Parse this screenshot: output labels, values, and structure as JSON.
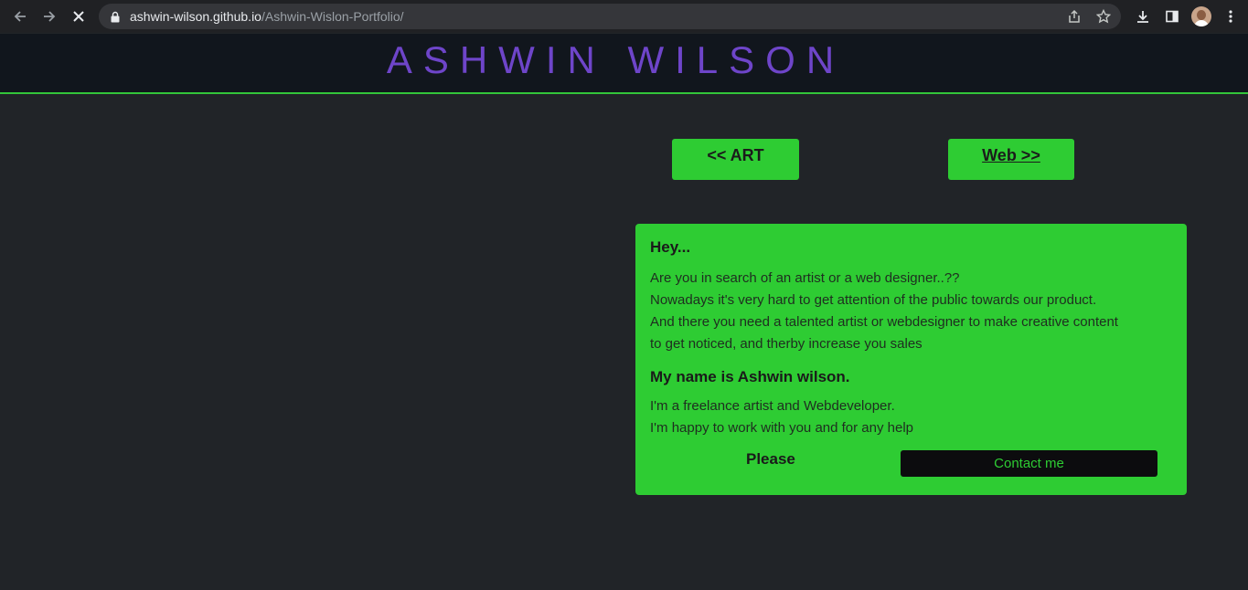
{
  "browser": {
    "url_host": "ashwin-wilson.github.io",
    "url_path": "/Ashwin-Wislon-Portfolio/",
    "icons": [
      "back-icon",
      "forward-icon",
      "stop-icon",
      "lock-icon",
      "share-icon",
      "star-icon",
      "download-icon",
      "sidepanel-icon",
      "profile-avatar",
      "menu-icon"
    ]
  },
  "header": {
    "title": "ASHWIN WILSON"
  },
  "nav": {
    "art_label": "<< ART",
    "web_label": "Web >>"
  },
  "card": {
    "greeting": "Hey...",
    "intro_lines": [
      "Are you in search of an artist or a web designer..??",
      "Nowadays it's very hard to get attention of the public towards our product.",
      "And there you need a talented artist or webdesigner to make creative content",
      "to get noticed, and therby increase you sales"
    ],
    "name_heading": "My name is Ashwin wilson.",
    "about_lines": [
      "I'm a freelance artist and Webdeveloper.",
      "I'm happy to work with you and for any help"
    ],
    "please_label": "Please",
    "contact_label": "Contact me"
  },
  "colors": {
    "page_bg": "#212428",
    "header_bg": "#11161d",
    "accent_green": "#2ecc33",
    "title_purple": "#6e45c9"
  }
}
